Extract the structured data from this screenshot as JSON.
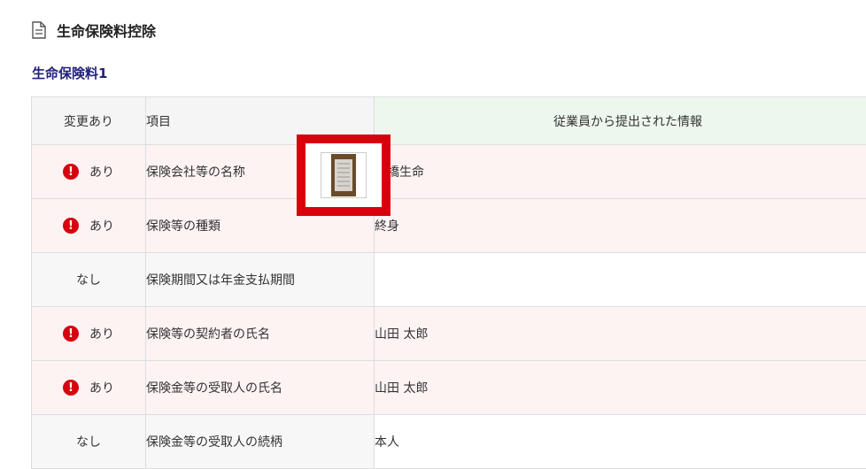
{
  "page": {
    "title": "生命保険料控除"
  },
  "section": {
    "title": "生命保険料1"
  },
  "table": {
    "headers": {
      "change": "変更あり",
      "item": "項目",
      "info": "従業員から提出された情報"
    },
    "rows": [
      {
        "change": "あり",
        "changed": true,
        "item": "保険会社等の名称",
        "value": "京橋生命"
      },
      {
        "change": "あり",
        "changed": true,
        "item": "保険等の種類",
        "value": "終身"
      },
      {
        "change": "なし",
        "changed": false,
        "item": "保険期間又は年金支払期間",
        "value": ""
      },
      {
        "change": "あり",
        "changed": true,
        "item": "保険等の契約者の氏名",
        "value": "山田 太郎"
      },
      {
        "change": "あり",
        "changed": true,
        "item": "保険金等の受取人の氏名",
        "value": "山田 太郎"
      },
      {
        "change": "なし",
        "changed": false,
        "item": "保険金等の受取人の続柄",
        "value": "本人"
      }
    ]
  },
  "icons": {
    "alert": "!",
    "alert_name": "alert-circle-icon",
    "header_icon": "document-icon",
    "thumbnail": "document-thumbnail"
  },
  "colors": {
    "alert": "#d7000f",
    "highlight_border": "#d9000d",
    "section_title": "#1f1f7a",
    "info_border": "#8cc68c",
    "changed_row_bg": "#fdf3f3"
  }
}
